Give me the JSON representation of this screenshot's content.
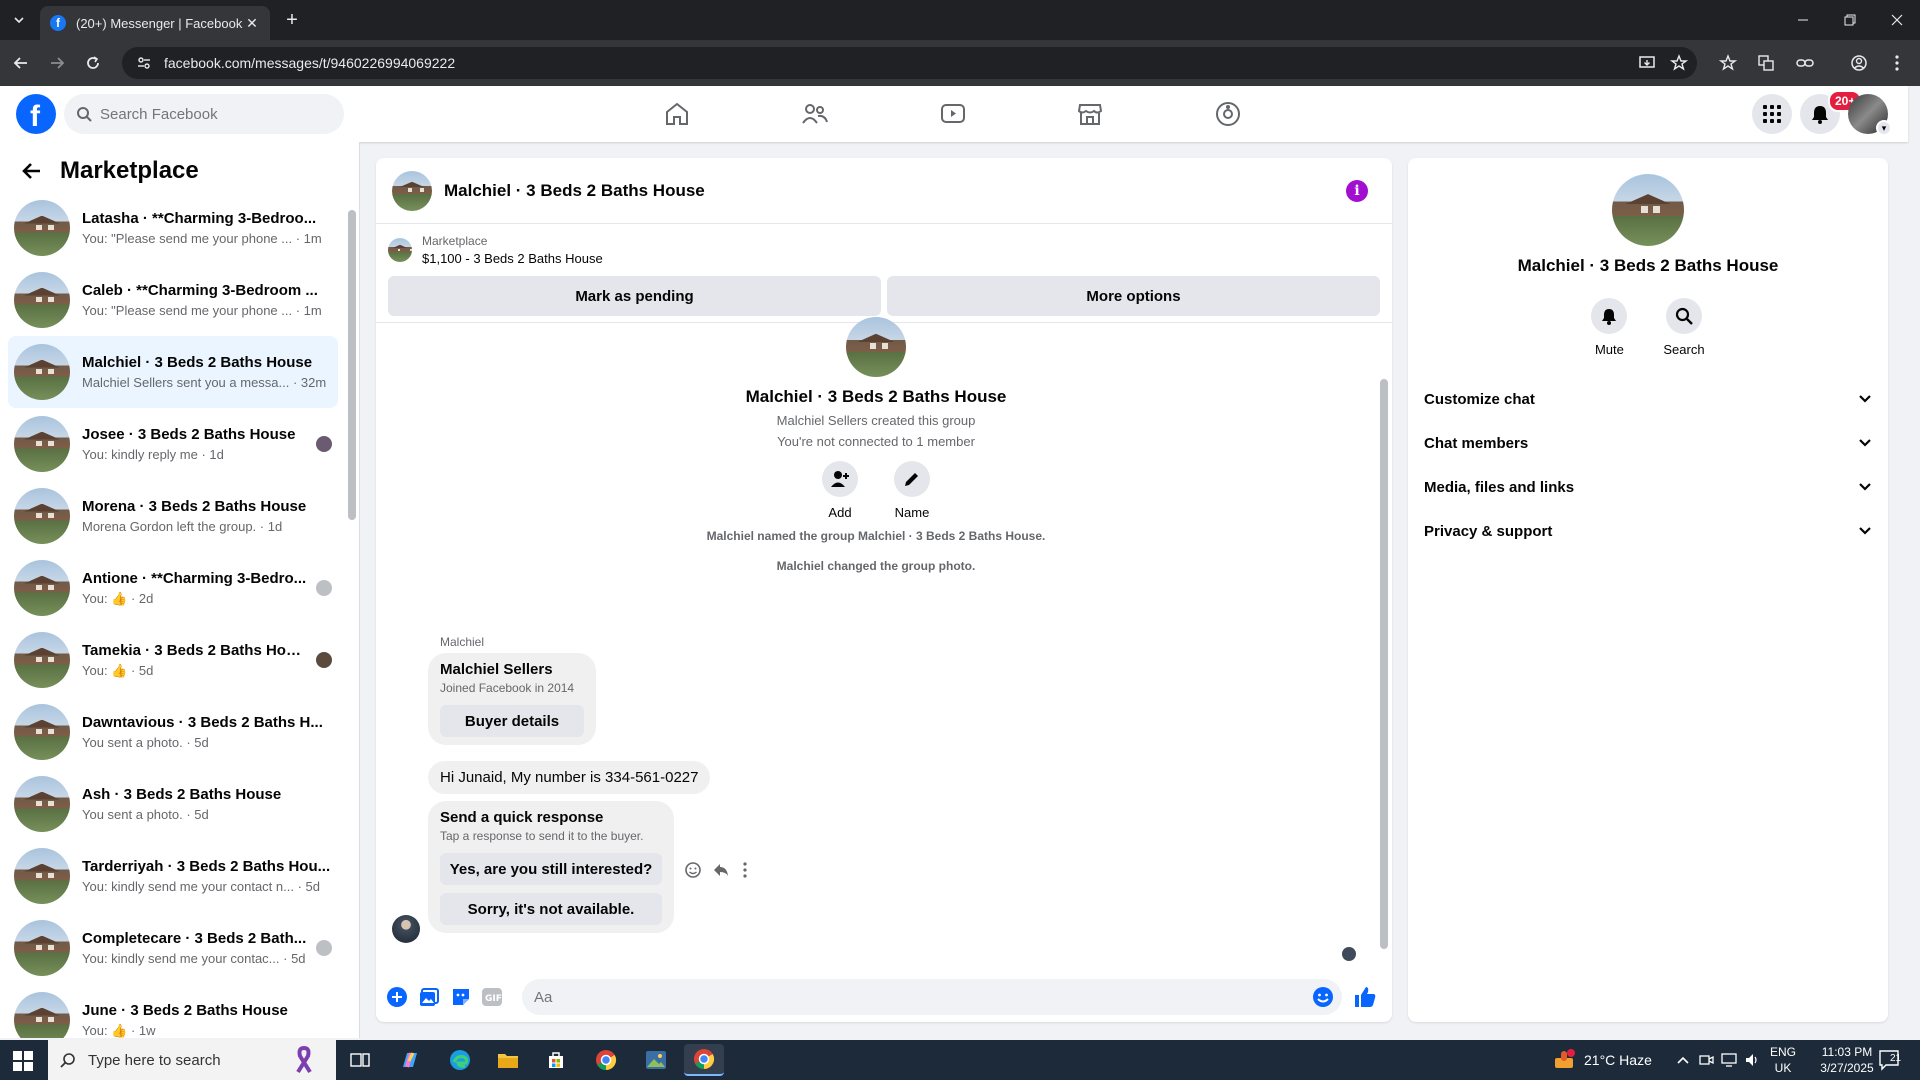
{
  "browser": {
    "tab_title": "(20+) Messenger | Facebook",
    "tab_favicon": "f",
    "url": "facebook.com/messages/t/9460226994069222"
  },
  "fb_nav": {
    "logo_letter": "f",
    "search_placeholder": "Search Facebook",
    "notification_badge": "20+"
  },
  "left_panel": {
    "title": "Marketplace",
    "conversations": [
      {
        "name": "Latasha · **Charming 3-Bedroo...",
        "preview": "You: \"Please send me your phone ... · 1m",
        "active": false
      },
      {
        "name": "Caleb · **Charming 3-Bedroom ...",
        "preview": "You: \"Please send me your phone ... · 1m",
        "active": false
      },
      {
        "name": "Malchiel · 3 Beds 2 Baths House",
        "preview": "Malchiel Sellers sent you a messa... · 32m",
        "active": true
      },
      {
        "name": "Josee · 3 Beds 2 Baths House",
        "preview": "You: kindly reply me · 1d",
        "active": false
      },
      {
        "name": "Morena · 3 Beds 2 Baths House",
        "preview": "Morena Gordon left the group. · 1d",
        "active": false
      },
      {
        "name": "Antione · **Charming 3-Bedro...",
        "preview": "You: 👍 · 2d",
        "active": false
      },
      {
        "name": "Tamekia · 3 Beds 2 Baths House",
        "preview": "You: 👍 · 5d",
        "active": false
      },
      {
        "name": "Dawntavious · 3 Beds 2 Baths H...",
        "preview": "You sent a photo. · 5d",
        "active": false
      },
      {
        "name": "Ash · 3 Beds 2 Baths House",
        "preview": "You sent a photo. · 5d",
        "active": false
      },
      {
        "name": "Tarderriyah · 3 Beds 2 Baths Hou...",
        "preview": "You: kindly send me your contact n... · 5d",
        "active": false
      },
      {
        "name": "Completecare · 3 Beds 2 Bath...",
        "preview": "You: kindly send me your contac... · 5d",
        "active": false
      },
      {
        "name": "June · 3 Beds 2 Baths House",
        "preview": "You: 👍 · 1w",
        "active": false
      }
    ]
  },
  "chat": {
    "title": "Malchiel · 3 Beds 2 Baths House",
    "listing_category": "Marketplace",
    "listing_price_title": "$1,100 - 3 Beds 2 Baths House",
    "mark_pending": "Mark as pending",
    "more_options": "More options",
    "group_name": "Malchiel · 3 Beds 2 Baths House",
    "created_line": "Malchiel Sellers created this group",
    "connected_line": "You're not connected to 1 member",
    "add_label": "Add",
    "name_label": "Name",
    "sys_msg_1": "Malchiel named the group Malchiel · 3 Beds 2 Baths House.",
    "sys_msg_2": "Malchiel changed the group photo.",
    "sender_name": "Malchiel",
    "profile_card_name": "Malchiel Sellers",
    "profile_card_sub": "Joined Facebook in 2014",
    "buyer_details": "Buyer details",
    "message_text": "Hi Junaid, My number is 334-561-0227",
    "quick_title": "Send a quick response",
    "quick_sub": "Tap a response to send it to the buyer.",
    "quick_1": "Yes, are you still interested?",
    "quick_2": "Sorry, it's not available.",
    "composer_placeholder": "Aa",
    "accent_color": "#0866ff"
  },
  "right_panel": {
    "name": "Malchiel · 3 Beds 2 Baths House",
    "mute_label": "Mute",
    "search_label": "Search",
    "sections": [
      "Customize chat",
      "Chat members",
      "Media, files and links",
      "Privacy & support"
    ]
  },
  "taskbar": {
    "search_placeholder": "Type here to search",
    "weather": "21°C  Haze",
    "lang_1": "ENG",
    "lang_2": "UK",
    "time": "11:03 PM",
    "date": "3/27/2025",
    "notif_count": "21"
  }
}
